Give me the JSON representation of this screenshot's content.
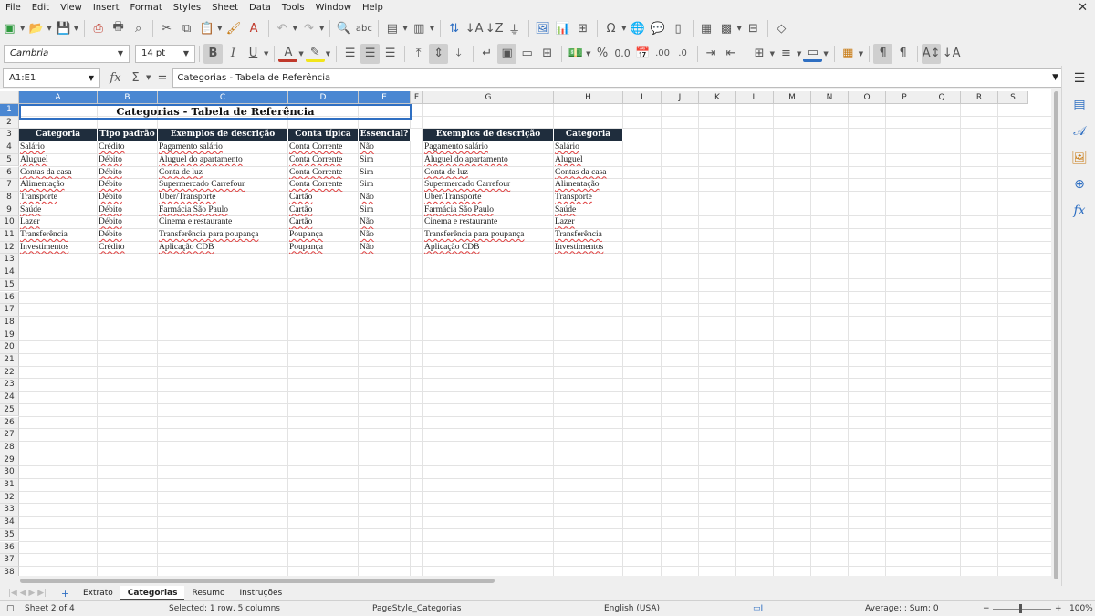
{
  "menu": [
    "File",
    "Edit",
    "View",
    "Insert",
    "Format",
    "Styles",
    "Sheet",
    "Data",
    "Tools",
    "Window",
    "Help"
  ],
  "format_bar": {
    "font_name": "Cambria",
    "font_size": "14 pt"
  },
  "name_box": "A1:E1",
  "formula": "Categorias - Tabela de Referência",
  "columns": [
    "A",
    "B",
    "C",
    "D",
    "E",
    "F",
    "G",
    "H",
    "I",
    "J",
    "K",
    "L",
    "M",
    "N",
    "O",
    "P",
    "Q",
    "R",
    "S"
  ],
  "selected_columns": [
    "A",
    "B",
    "C",
    "D",
    "E"
  ],
  "rows": [
    "1",
    "2",
    "3",
    "4",
    "5",
    "6",
    "7",
    "8",
    "9",
    "10",
    "11",
    "12",
    "13",
    "14",
    "15",
    "16",
    "17",
    "18",
    "19",
    "20",
    "21",
    "22",
    "23",
    "24",
    "25",
    "26",
    "27",
    "28",
    "29",
    "30",
    "31",
    "32",
    "33",
    "34",
    "35",
    "36",
    "37",
    "38"
  ],
  "selected_row": "1",
  "title": "Categorias - Tabela de Referência",
  "table1": {
    "headers": [
      "Categoria",
      "Tipo padrão",
      "Exemplos de descrição",
      "Conta típica",
      "Essencial?"
    ],
    "rows": [
      [
        "Salário",
        "Crédito",
        "Pagamento salário",
        "Conta Corrente",
        "Não"
      ],
      [
        "Aluguel",
        "Débito",
        "Aluguel do apartamento",
        "Conta Corrente",
        "Sim"
      ],
      [
        "Contas da casa",
        "Débito",
        "Conta de luz",
        "Conta Corrente",
        "Sim"
      ],
      [
        "Alimentação",
        "Débito",
        "Supermercado Carrefour",
        "Conta Corrente",
        "Sim"
      ],
      [
        "Transporte",
        "Débito",
        "Uber/Transporte",
        "Cartão",
        "Não"
      ],
      [
        "Saúde",
        "Débito",
        "Farmácia São Paulo",
        "Cartão",
        "Sim"
      ],
      [
        "Lazer",
        "Débito",
        "Cinema e restaurante",
        "Cartão",
        "Não"
      ],
      [
        "Transferência",
        "Débito",
        "Transferência para poupança",
        "Poupança",
        "Não"
      ],
      [
        "Investimentos",
        "Crédito",
        "Aplicação CDB",
        "Poupança",
        "Não"
      ]
    ]
  },
  "table2": {
    "headers": [
      "Exemplos de descrição",
      "Categoria"
    ],
    "rows": [
      [
        "Pagamento salário",
        "Salário"
      ],
      [
        "Aluguel do apartamento",
        "Aluguel"
      ],
      [
        "Conta de luz",
        "Contas da casa"
      ],
      [
        "Supermercado Carrefour",
        "Alimentação"
      ],
      [
        "Uber/Transporte",
        "Transporte"
      ],
      [
        "Farmácia São Paulo",
        "Saúde"
      ],
      [
        "Cinema e restaurante",
        "Lazer"
      ],
      [
        "Transferência para poupança",
        "Transferência"
      ],
      [
        "Aplicação CDB",
        "Investimentos"
      ]
    ]
  },
  "tabs": [
    "Extrato",
    "Categorias",
    "Resumo",
    "Instruções"
  ],
  "active_tab": "Categorias",
  "status": {
    "sheet": "Sheet 2 of 4",
    "selection": "Selected: 1 row, 5 columns",
    "page_style": "PageStyle_Categorias",
    "language": "English (USA)",
    "sum": "Average: ; Sum: 0",
    "zoom": "100%"
  },
  "colors": {
    "header_bg": "#1f2d3d",
    "selection": "#4a87d2",
    "accent": "#2f6fc2"
  }
}
